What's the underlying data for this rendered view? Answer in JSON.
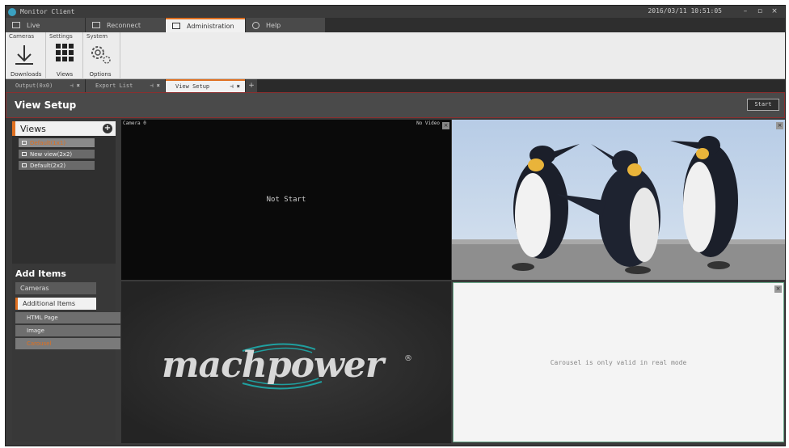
{
  "app": {
    "title": "Monitor Client",
    "clock": "2016/03/11 10:51:05"
  },
  "window_controls": {
    "minimize": "–",
    "maximize": "▫",
    "close": "×"
  },
  "main_tabs": [
    {
      "label": "Live"
    },
    {
      "label": "Reconnect"
    },
    {
      "label": "Administration"
    },
    {
      "label": "Help"
    }
  ],
  "ribbon": {
    "groups": [
      {
        "label": "Cameras",
        "button": "Downloads"
      },
      {
        "label": "Settings",
        "button": "Views"
      },
      {
        "label": "System",
        "button": "Options"
      }
    ]
  },
  "doc_tabs": [
    {
      "label": "Output(0x0)"
    },
    {
      "label": "Export List"
    },
    {
      "label": "View Setup"
    }
  ],
  "doc_tab_controls": {
    "pin": "⊣",
    "close": "✖",
    "add": "+"
  },
  "header": {
    "title": "View Setup",
    "start_button": "Start"
  },
  "views_panel": {
    "title": "Views",
    "add": "+",
    "items": [
      {
        "label": "Default(1x1)"
      },
      {
        "label": "New view(2x2)"
      },
      {
        "label": "Default(2x2)"
      }
    ]
  },
  "add_items": {
    "title": "Add Items",
    "cameras": "Cameras",
    "additional": "Additional Items",
    "subitems": [
      {
        "label": "HTML Page"
      },
      {
        "label": "Image"
      },
      {
        "label": "Carousel"
      }
    ]
  },
  "grid": {
    "cell1": {
      "label": "Camera 0",
      "label_right": "No Video",
      "message": "Not Start"
    },
    "cell2": {
      "close": "×"
    },
    "cell3": {
      "logo": "machpower",
      "logo_mark": "®"
    },
    "cell4": {
      "close": "×",
      "message": "Carousel is only valid in real mode"
    }
  },
  "colors": {
    "accent": "#e07020",
    "title_border": "#8b2f2f",
    "selected_border": "#6aa88a"
  }
}
